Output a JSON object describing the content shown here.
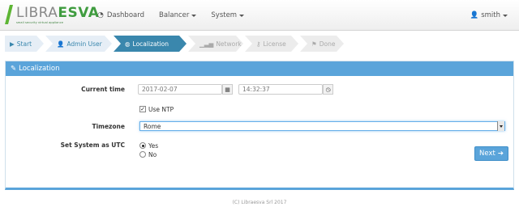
{
  "brand": {
    "name_left": "LIBRA",
    "name_accent": "ESVA",
    "tagline": "small security virtual appliance"
  },
  "nav": {
    "dashboard": "Dashboard",
    "balancer": "Balancer",
    "system": "System",
    "user": "smith"
  },
  "steps": [
    {
      "label": "Start"
    },
    {
      "label": "Admin User"
    },
    {
      "label": "Localization"
    },
    {
      "label": "Network"
    },
    {
      "label": "License"
    },
    {
      "label": "Done"
    }
  ],
  "panel": {
    "title": "Localization"
  },
  "form": {
    "current_time_label": "Current time",
    "date_value": "2017-02-07",
    "time_value": "14:32:37",
    "use_ntp_label": "Use NTP",
    "use_ntp_checked": true,
    "timezone_label": "Timezone",
    "timezone_value": "Rome",
    "utc_label": "Set System as UTC",
    "utc_yes": "Yes",
    "utc_no": "No",
    "utc_selected": "Yes"
  },
  "next_button": "Next",
  "footer": "(C) Libraesva Srl 2017",
  "colors": {
    "primary": "#5aa4da",
    "step_active": "#3a87ad",
    "brand_green": "#5db534"
  }
}
